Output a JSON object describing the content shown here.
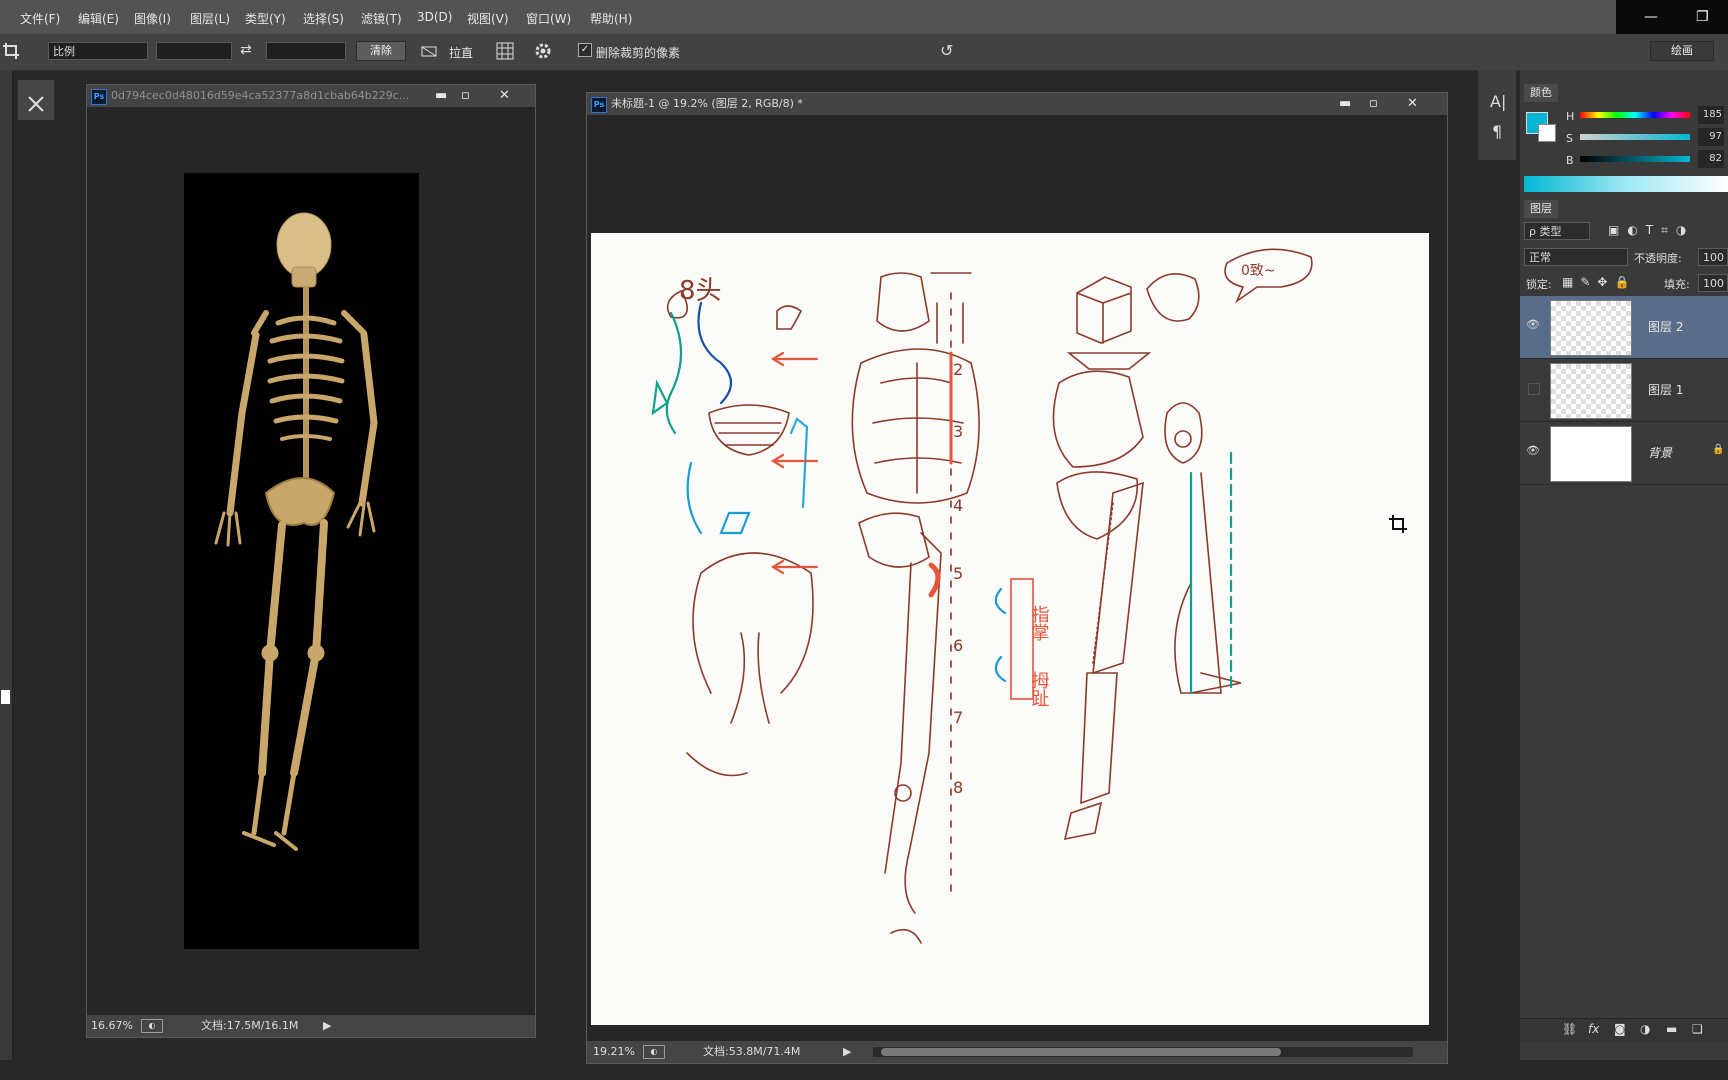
{
  "menu": {
    "items": [
      "文件(F)",
      "编辑(E)",
      "图像(I)",
      "图层(L)",
      "类型(Y)",
      "选择(S)",
      "滤镜(T)",
      "3D(D)",
      "视图(V)",
      "窗口(W)",
      "帮助(H)"
    ]
  },
  "window_controls": {
    "minimize": "—",
    "restore": "❐"
  },
  "options": {
    "crop_icon": "crop-icon",
    "ratio_select": "比例",
    "swap": "⇄",
    "clear_label": "清除",
    "straighten_label": "拉直",
    "delete_pixels_checked": true,
    "delete_pixels_label": "删除裁剪的像素",
    "reset_symbol": "↺",
    "workspace": "绘画"
  },
  "doc1": {
    "title": "0d794cec0d48016d59e4ca52377a8d1cbab64b229c...",
    "zoom": "16.67%",
    "doc_size": "文档:17.5M/16.1M"
  },
  "doc2": {
    "title": "未标题-1 @ 19.2% (图层 2, RGB/8) *",
    "zoom": "19.21%",
    "doc_size": "文档:53.8M/71.4M"
  },
  "sketch": {
    "heads_text": "8头",
    "speech_text": "0致~",
    "numbers": [
      "2",
      "3",
      "4",
      "5",
      "6",
      "7",
      "8"
    ],
    "label_a": "指掌",
    "label_b": "拇趾"
  },
  "color_panel": {
    "tab": "颜色",
    "h_label": "H",
    "h_value": "185",
    "s_label": "S",
    "s_value": "97",
    "b_label": "B",
    "b_value": "82",
    "fg_color": "#04b6d4",
    "bg_color": "#ffffff"
  },
  "layers_panel": {
    "tab": "图层",
    "filter_kind": "ρ 类型",
    "blend_mode": "正常",
    "opacity_label": "不透明度:",
    "opacity_value": "100",
    "lock_label": "锁定:",
    "fill_label": "填充:",
    "fill_value": "100",
    "layers": [
      {
        "name": "图层 2",
        "visible": true,
        "selected": true
      },
      {
        "name": "图层 1",
        "visible": false,
        "selected": false
      },
      {
        "name": "背景",
        "visible": true,
        "selected": false
      }
    ],
    "footer_icons": [
      "link-icon",
      "fx-icon",
      "mask-icon",
      "adjustment-icon",
      "folder-icon",
      "new-layer-icon"
    ]
  }
}
